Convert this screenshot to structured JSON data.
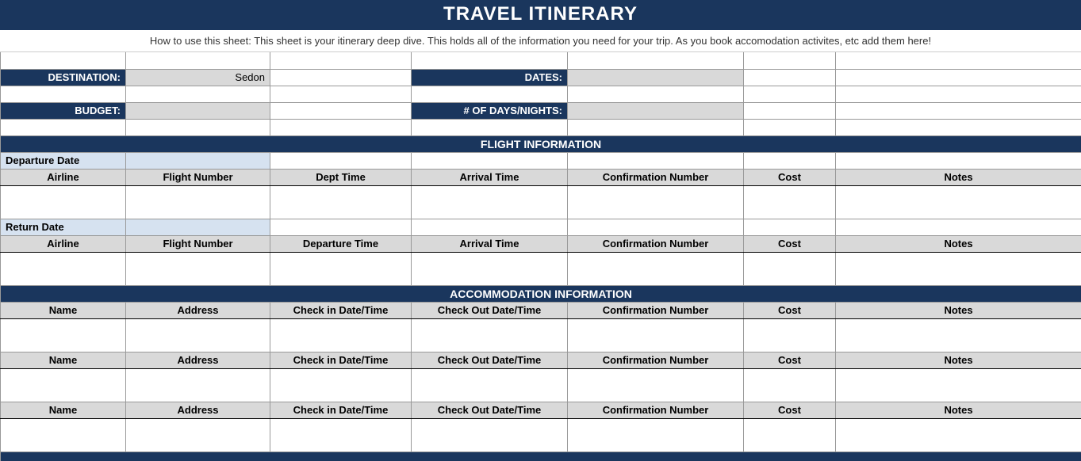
{
  "title": "TRAVEL ITINERARY",
  "instructions": "How to use this sheet: This sheet is your itinerary deep dive. This holds all of the information you need for your trip. As you book accomodation activites, etc add them here!",
  "labels": {
    "destination": "DESTINATION:",
    "budget": "BUDGET:",
    "dates": "DATES:",
    "days_nights": "# OF DAYS/NIGHTS:"
  },
  "values": {
    "destination": "Sedon",
    "budget": "",
    "dates": "",
    "days_nights": ""
  },
  "sections": {
    "flight": "FLIGHT INFORMATION",
    "accommodation": "ACCOMMODATION INFORMATION"
  },
  "flight": {
    "departure_label": "Departure Date",
    "return_label": "Return Date",
    "headers_depart": [
      "Airline",
      "Flight Number",
      "Dept Time",
      "Arrival Time",
      "Confirmation Number",
      "Cost",
      "Notes"
    ],
    "headers_return": [
      "Airline",
      "Flight Number",
      "Departure Time",
      "Arrival Time",
      "Confirmation Number",
      "Cost",
      "Notes"
    ]
  },
  "accom": {
    "headers": [
      "Name",
      "Address",
      "Check in Date/Time",
      "Check Out Date/Time",
      "Confirmation Number",
      "Cost",
      "Notes"
    ]
  }
}
